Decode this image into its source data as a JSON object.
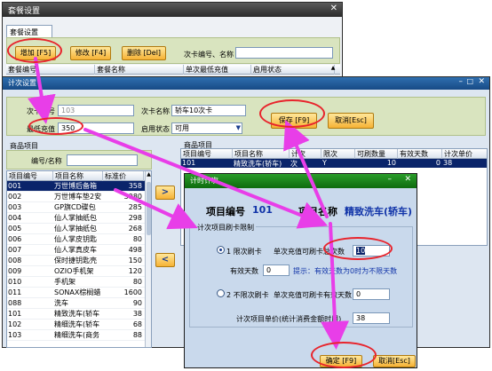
{
  "back_window": {
    "title": "套餐设置",
    "tab_label": "套餐设置",
    "buttons": {
      "add": "增加 [F5]",
      "edit": "修改 [F4]",
      "delete": "删除 [Del]"
    },
    "search_label": "次卡编号、名称",
    "search_value": "",
    "columns": [
      "套餐编号",
      "套餐名称",
      "单次最低充值",
      "启用状态"
    ]
  },
  "count_card_window": {
    "title": "计次设置",
    "card_no_label": "次卡编号",
    "card_no_value": "103",
    "card_name_label": "次卡名称",
    "card_name_value": "轿车10次卡",
    "min_recharge_label": "最低充值",
    "min_recharge_value": "350",
    "enable_label": "启用状态",
    "enable_value": "可用",
    "save_button": "保存 [F9]",
    "cancel_button": "取消[Esc]",
    "goods_section_label": "商品项目",
    "code_name_label": "编号/名称",
    "code_name_value": "",
    "left_grid": {
      "columns": [
        "项目编号",
        "项目名称",
        "标准价"
      ],
      "rows": [
        {
          "code": "001",
          "name": "万世博后备箱",
          "price": "358"
        },
        {
          "code": "002",
          "name": "万世博车垫2安",
          "price": "3980"
        },
        {
          "code": "003",
          "name": "GP旗CD碟包",
          "price": "285"
        },
        {
          "code": "004",
          "name": "仙人掌抽纸包",
          "price": "298"
        },
        {
          "code": "005",
          "name": "仙人掌抽纸包",
          "price": "268"
        },
        {
          "code": "006",
          "name": "仙人掌皮钥匙",
          "price": "80"
        },
        {
          "code": "007",
          "name": "仙人掌真皮车",
          "price": "498"
        },
        {
          "code": "008",
          "name": "保时捷钥匙壳",
          "price": "150"
        },
        {
          "code": "009",
          "name": "OZIO手机架",
          "price": "120"
        },
        {
          "code": "010",
          "name": "手机架",
          "price": "80"
        },
        {
          "code": "011",
          "name": "SONAX棕榈蜡",
          "price": "1600"
        },
        {
          "code": "088",
          "name": "洗车",
          "price": "90"
        },
        {
          "code": "101",
          "name": "精致洗车(轿车",
          "price": "38"
        },
        {
          "code": "102",
          "name": "精细洗车(轿车",
          "price": "68"
        },
        {
          "code": "103",
          "name": "精细洗车(商务",
          "price": "88"
        }
      ]
    },
    "move_right": ">",
    "move_left": "<",
    "right_section_label": "商品项目",
    "right_grid": {
      "columns": [
        "项目编号",
        "项目名称",
        "计次",
        "限次",
        "可刷数量",
        "有效天数",
        "计次单价"
      ],
      "rows": [
        {
          "code": "101",
          "name": "精致洗车(轿车)",
          "count": "次",
          "limit": "Y",
          "qty": "10",
          "days": "0",
          "unit_price": "38"
        }
      ]
    }
  },
  "count_dialog": {
    "title": "计时计次",
    "item_code_label": "项目编号",
    "item_code_value": "101",
    "item_name_label": "项目名称",
    "item_name_value": "精致洗车(轿车)",
    "limit_group_label": "计次项目刷卡限制",
    "opt1_label": "1 限次刷卡",
    "opt1_qty_label": "单次充值可刷卡总次数",
    "opt1_qty_value": "10",
    "valid_days_label": "有效天数",
    "valid_days_value": "0",
    "hint": "提示：有效天数为0时为不限天数",
    "opt2_label": "2 不限次刷卡",
    "opt2_days_label": "单次充值可刷卡有效天数",
    "opt2_days_value": "0",
    "unit_price_label": "计次项目单价(统计消费金额时用)",
    "unit_price_value": "38",
    "confirm_button": "确定 [F9]",
    "cancel_button": "取消[Esc]"
  },
  "colors": {
    "arrow": "#e83ee8",
    "highlight": "#e8242c",
    "accent": "#0a246a"
  }
}
